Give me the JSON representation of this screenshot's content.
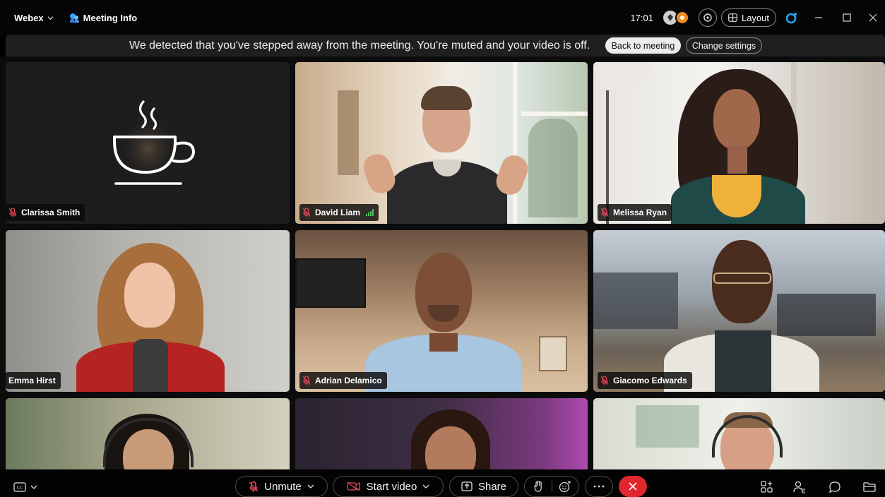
{
  "titlebar": {
    "app_name": "Webex",
    "meeting_info_label": "Meeting Info",
    "time": "17:01",
    "layout_label": "Layout"
  },
  "banner": {
    "message": "We detected that you've stepped away from the meeting. You're muted and your video is off.",
    "back_button": "Back to meeting",
    "settings_button": "Change settings"
  },
  "participants": [
    {
      "name": "Clarissa Smith",
      "muted": true,
      "video": false
    },
    {
      "name": "David Liam",
      "muted": true,
      "video": true,
      "active_speaker": true
    },
    {
      "name": "Melissa Ryan",
      "muted": true,
      "video": true
    },
    {
      "name": "Emma Hirst",
      "muted": false,
      "video": true
    },
    {
      "name": "Adrian Delamico",
      "muted": true,
      "video": true
    },
    {
      "name": "Giacomo Edwards",
      "muted": true,
      "video": true
    }
  ],
  "toolbar": {
    "unmute_label": "Unmute",
    "start_video_label": "Start video",
    "share_label": "Share"
  },
  "colors": {
    "accent_teal": "#2ec8b4",
    "end_call_red": "#e0262e",
    "mic_muted_red": "#e8455a"
  },
  "icons": [
    "chevron-down-icon",
    "webex-meeting-icon",
    "presence-icon",
    "search-icon",
    "layout-icon",
    "webex-logo-icon",
    "minimize-icon",
    "maximize-icon",
    "close-icon",
    "coffee-cup-icon",
    "mic-off-icon",
    "signal-icon",
    "captions-icon",
    "video-off-icon",
    "share-icon",
    "raise-hand-icon",
    "reactions-icon",
    "more-icon",
    "end-call-icon",
    "apps-icon",
    "participants-icon",
    "chat-icon",
    "folder-icon"
  ]
}
